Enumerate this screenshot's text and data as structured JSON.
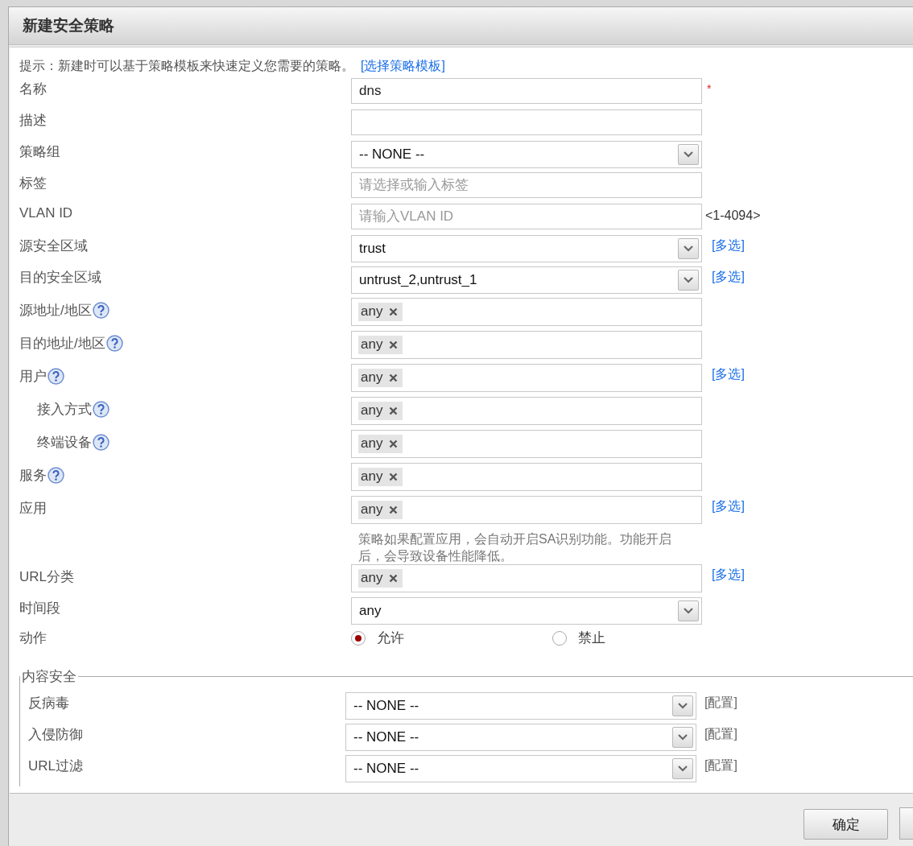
{
  "dialog": {
    "title": "新建安全策略",
    "hint": "提示：新建时可以基于策略模板来快速定义您需要的策略。",
    "hint_link": "[选择策略模板]"
  },
  "fields": [
    {
      "label": "名称",
      "kind": "text",
      "value": "dns",
      "required_mark": "*"
    },
    {
      "label": "描述",
      "kind": "text"
    },
    {
      "label": "策略组",
      "kind": "select",
      "value": "-- NONE --"
    },
    {
      "label": "标签",
      "kind": "text",
      "placeholder": "请选择或输入标签"
    },
    {
      "label": "VLAN ID",
      "kind": "text",
      "placeholder": "请输入VLAN ID",
      "suffix": "<1-4094>"
    },
    {
      "label": "源安全区域",
      "kind": "select",
      "value": "trust",
      "link": "[多选]"
    },
    {
      "label": "目的安全区域",
      "kind": "select",
      "value": "untrust_2,untrust_1",
      "link": "[多选]"
    },
    {
      "label": "源地址/地区",
      "kind": "tags",
      "help": true,
      "tags": [
        "any"
      ]
    },
    {
      "label": "目的地址/地区",
      "kind": "tags",
      "help": true,
      "tags": [
        "any"
      ]
    },
    {
      "label": "用户",
      "kind": "tags",
      "help": true,
      "tags": [
        "any"
      ],
      "link": "[多选]",
      "children": [
        {
          "label": "接入方式",
          "kind": "tags",
          "help": true,
          "tags": [
            "any"
          ]
        },
        {
          "label": "终端设备",
          "kind": "tags",
          "help": true,
          "tags": [
            "any"
          ]
        }
      ]
    },
    {
      "label": "服务",
      "kind": "tags",
      "help": true,
      "tags": [
        "any"
      ]
    },
    {
      "label": "应用",
      "kind": "tags",
      "tags": [
        "any"
      ],
      "link": "[多选]",
      "note": "策略如果配置应用，会自动开启SA识别功能。功能开启后，会导致设备性能降低。"
    },
    {
      "label": "URL分类",
      "kind": "tags",
      "tags": [
        "any"
      ],
      "link": "[多选]"
    },
    {
      "label": "时间段",
      "kind": "select",
      "value": "any"
    },
    {
      "label": "动作",
      "kind": "radio",
      "options": [
        {
          "label": "允许",
          "selected": true
        },
        {
          "label": "禁止",
          "selected": false
        }
      ]
    }
  ],
  "content_security": {
    "legend": "内容安全",
    "rows": [
      {
        "label": "反病毒",
        "value": "-- NONE --",
        "link": "[配置]"
      },
      {
        "label": "入侵防御",
        "value": "-- NONE --",
        "link": "[配置]"
      },
      {
        "label": "URL过滤",
        "value": "-- NONE --",
        "link": "[配置]"
      }
    ]
  },
  "footer": {
    "buttons": [
      "确定"
    ]
  }
}
